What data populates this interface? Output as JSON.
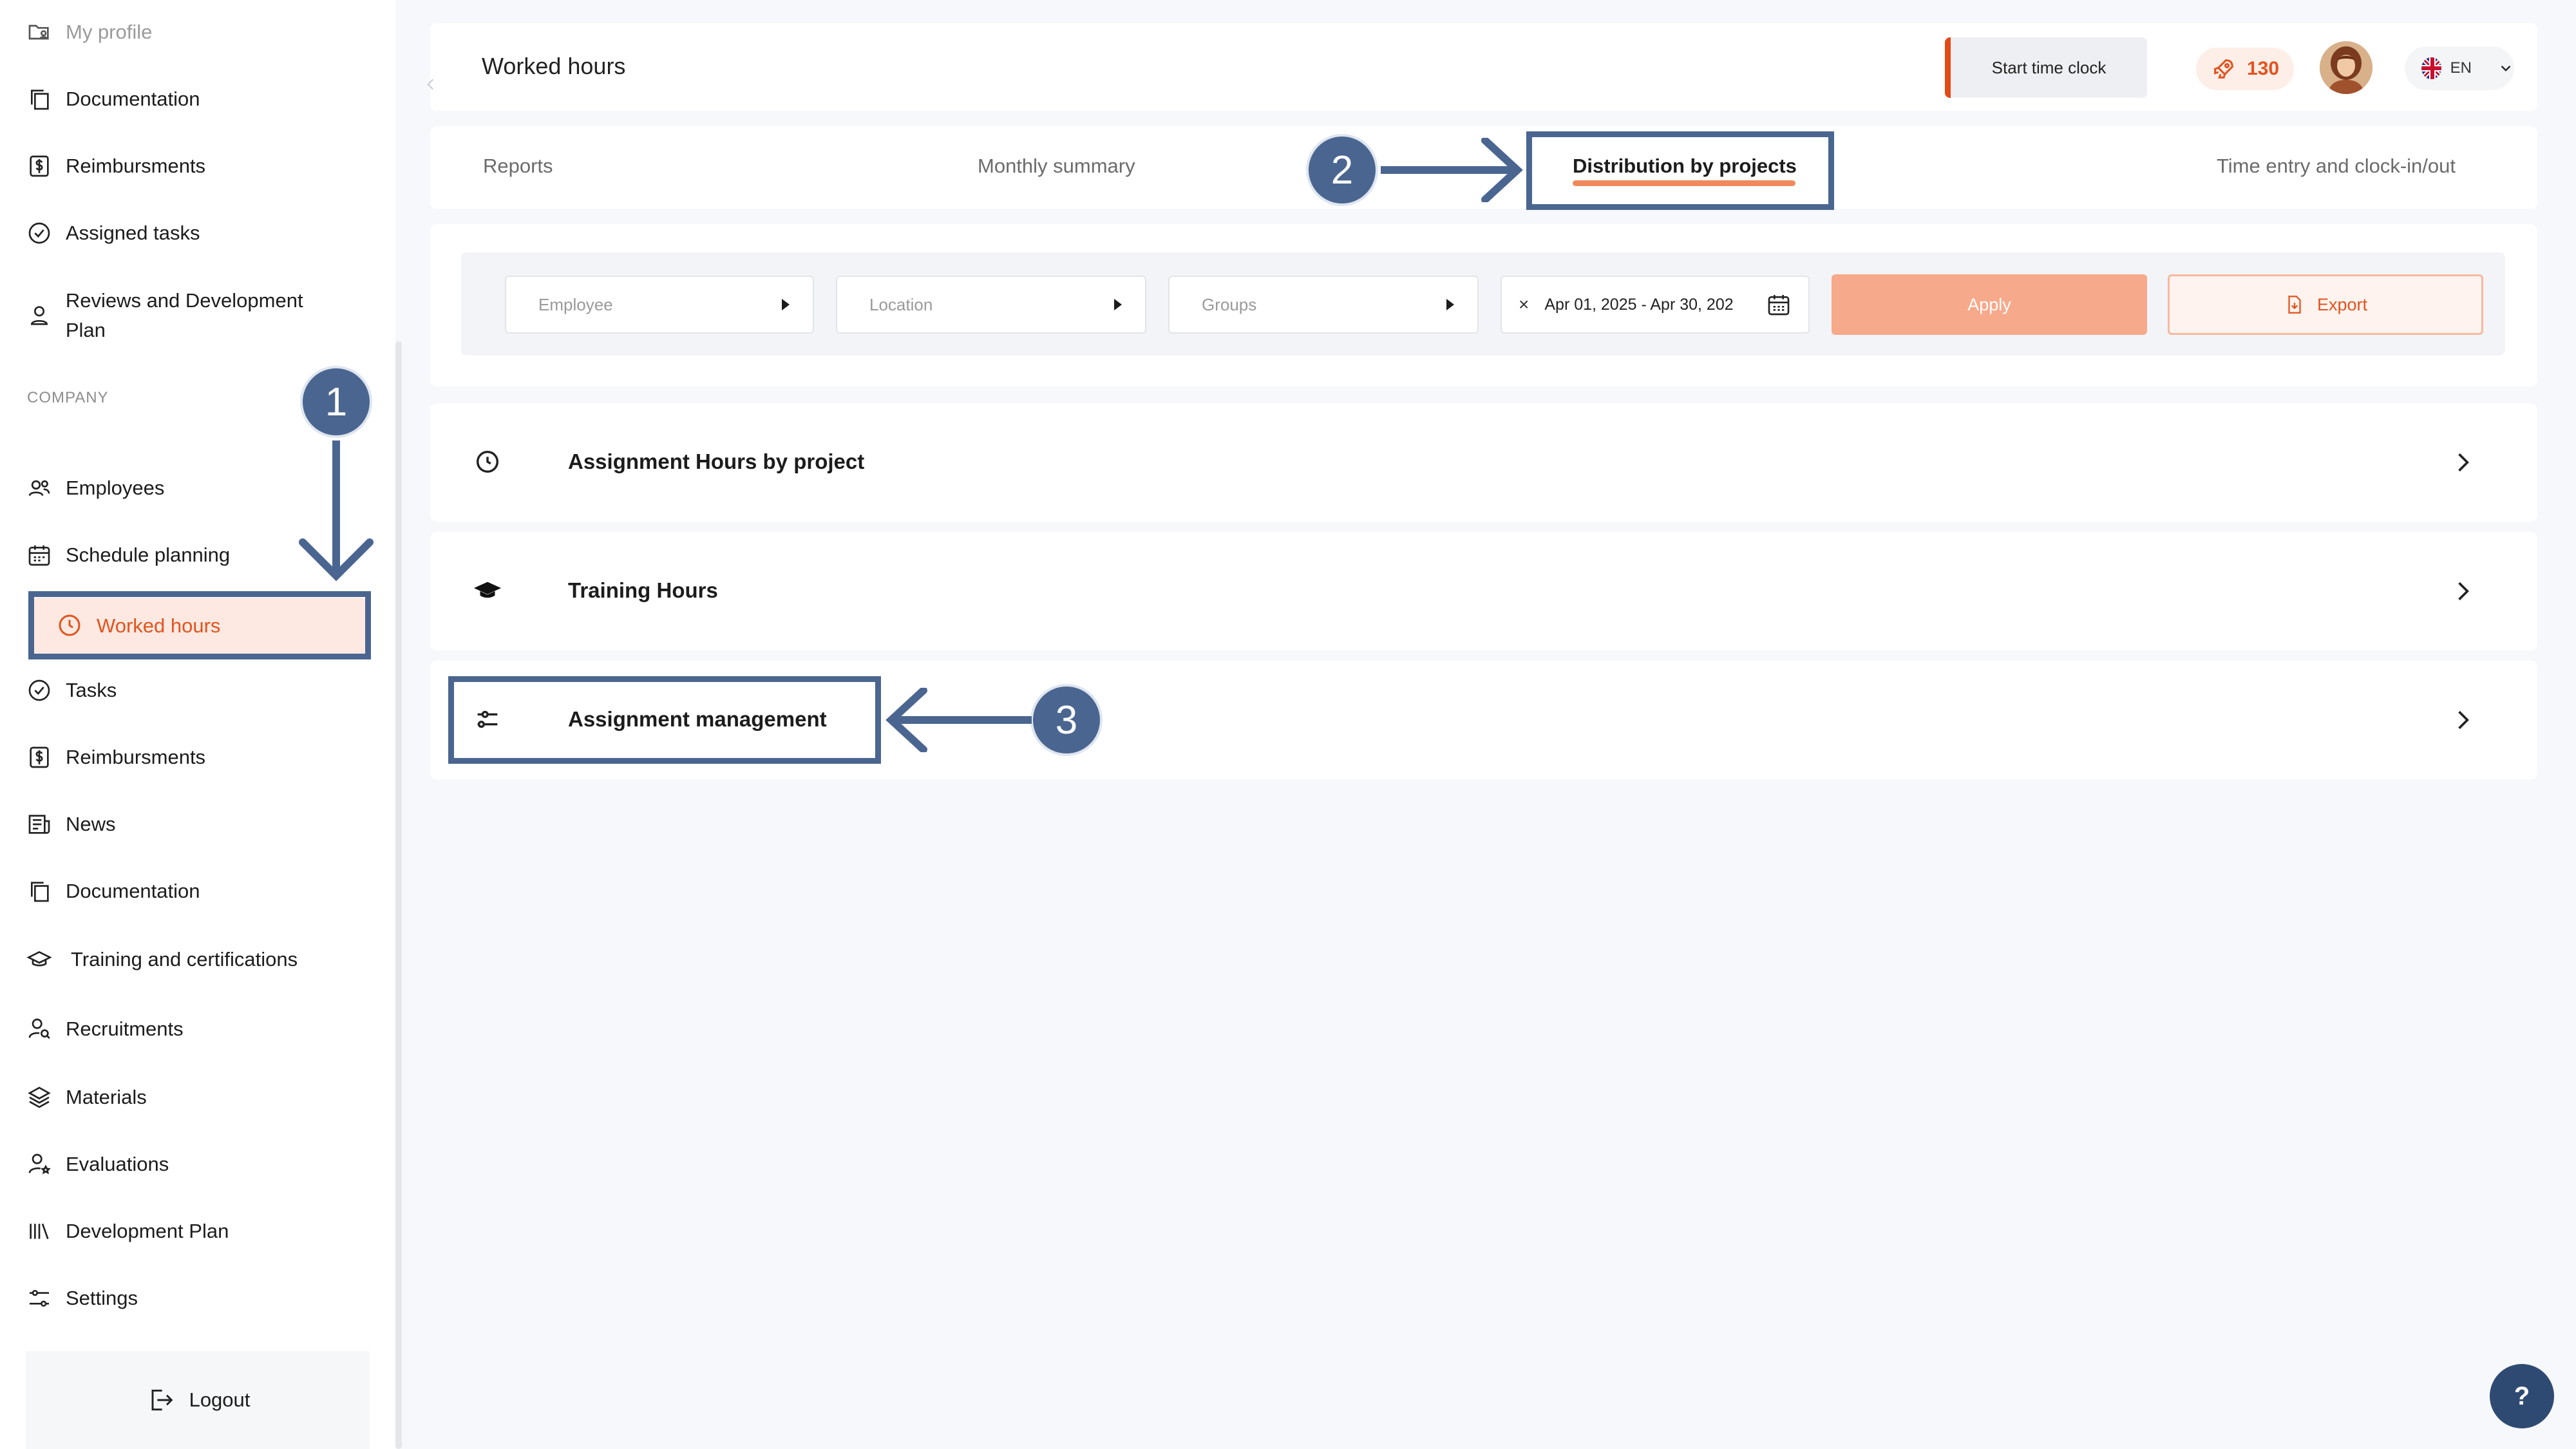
{
  "sidebar": {
    "top_items": [
      {
        "label": "My profile",
        "icon": "profile-folder-icon"
      },
      {
        "label": "Documentation",
        "icon": "documents-icon"
      },
      {
        "label": "Reimbursments",
        "icon": "dollar-icon"
      },
      {
        "label": "Assigned tasks",
        "icon": "check-circle-icon"
      },
      {
        "label": "Reviews and Development Plan",
        "icon": "user-icon"
      }
    ],
    "section_label": "COMPANY",
    "company_items": [
      {
        "label": "Employees",
        "icon": "users-icon"
      },
      {
        "label": "Schedule planning",
        "icon": "calendar-icon"
      },
      {
        "label": "Worked hours",
        "icon": "clock-icon",
        "active": true
      },
      {
        "label": "Tasks",
        "icon": "check-circle-icon"
      },
      {
        "label": "Reimbursments",
        "icon": "dollar-icon"
      },
      {
        "label": "News",
        "icon": "news-icon"
      },
      {
        "label": "Documentation",
        "icon": "documents-icon"
      },
      {
        "label": "Training and certifications",
        "icon": "graduation-cap-icon"
      },
      {
        "label": "Recruitments",
        "icon": "user-search-icon"
      },
      {
        "label": "Materials",
        "icon": "layers-icon"
      },
      {
        "label": "Evaluations",
        "icon": "user-star-icon"
      },
      {
        "label": "Development Plan",
        "icon": "bars-icon"
      },
      {
        "label": "Settings",
        "icon": "sliders-icon"
      }
    ],
    "logout_label": "Logout"
  },
  "header": {
    "title": "Worked hours",
    "start_clock_label": "Start time clock",
    "points": "130",
    "language": "EN"
  },
  "tabs": [
    {
      "label": "Reports"
    },
    {
      "label": "Monthly summary"
    },
    {
      "label": "Distribution by projects",
      "active": true
    },
    {
      "label": "Time entry and clock-in/out"
    }
  ],
  "filters": {
    "employee_placeholder": "Employee",
    "location_placeholder": "Location",
    "groups_placeholder": "Groups",
    "date_range": "Apr 01, 2025 - Apr 30, 202",
    "apply_label": "Apply",
    "export_label": "Export"
  },
  "rows": [
    {
      "label": "Assignment Hours by project",
      "icon": "clock-icon"
    },
    {
      "label": "Training Hours",
      "icon": "graduation-cap-icon"
    },
    {
      "label": "Assignment management",
      "icon": "sliders-icon"
    }
  ],
  "annotations": {
    "step1": "1",
    "step2": "2",
    "step3": "3",
    "accent_color": "#4a6690"
  },
  "help_label": "?",
  "colors": {
    "brand": "#e2531f",
    "active_bg": "#fde9e1",
    "apply_bg": "#f7a98b"
  }
}
